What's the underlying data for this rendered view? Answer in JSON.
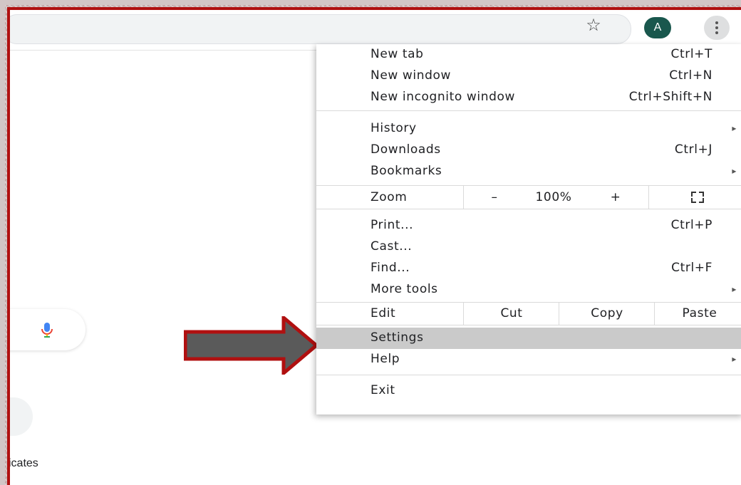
{
  "toolbar": {
    "star_icon": "star-icon",
    "avatar_letter": "A",
    "menu_icon": "kebab-menu-icon",
    "avatar_color": "#19574d"
  },
  "page": {
    "shortcut_label_fragment": "icates"
  },
  "menu": {
    "new_tab": {
      "label": "New tab",
      "shortcut": "Ctrl+T"
    },
    "new_window": {
      "label": "New window",
      "shortcut": "Ctrl+N"
    },
    "new_incognito": {
      "label": "New incognito window",
      "shortcut": "Ctrl+Shift+N"
    },
    "history": {
      "label": "History"
    },
    "downloads": {
      "label": "Downloads",
      "shortcut": "Ctrl+J"
    },
    "bookmarks": {
      "label": "Bookmarks"
    },
    "zoom": {
      "label": "Zoom",
      "minus": "–",
      "value": "100%",
      "plus": "+"
    },
    "print": {
      "label": "Print...",
      "shortcut": "Ctrl+P"
    },
    "cast": {
      "label": "Cast..."
    },
    "find": {
      "label": "Find...",
      "shortcut": "Ctrl+F"
    },
    "more_tools": {
      "label": "More tools"
    },
    "edit": {
      "label": "Edit",
      "cut": "Cut",
      "copy": "Copy",
      "paste": "Paste"
    },
    "settings": {
      "label": "Settings",
      "highlight_color": "#cacaca"
    },
    "help": {
      "label": "Help"
    },
    "exit": {
      "label": "Exit"
    },
    "submenu_arrow": "▸"
  },
  "annotation": {
    "arrow_fill": "#5a5a5a",
    "arrow_stroke": "#b01010"
  }
}
